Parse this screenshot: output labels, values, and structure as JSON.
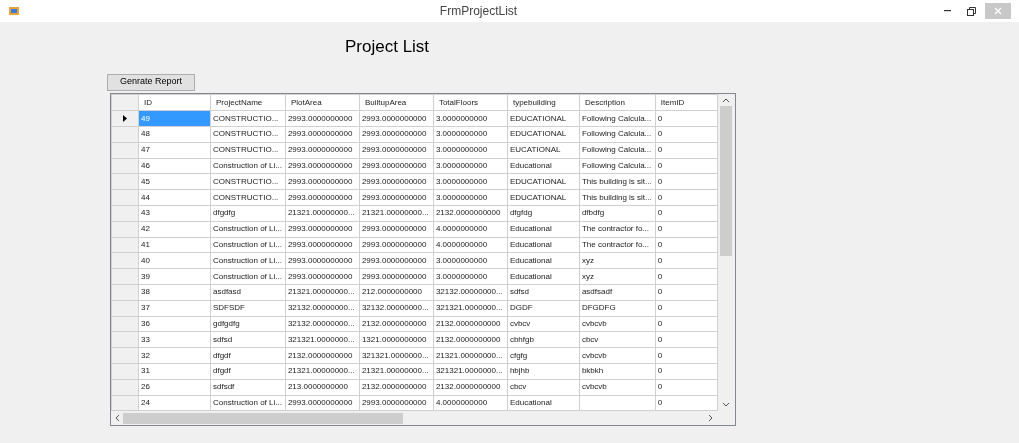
{
  "window": {
    "title": "FrmProjectList"
  },
  "heading": "Project List",
  "report_button": "Genrate Report",
  "table": {
    "columns": [
      "ID",
      "ProjectName",
      "PlotArea",
      "BuiltupArea",
      "TotalFloors",
      "typebuilding",
      "Description",
      "ItemID"
    ],
    "rows": [
      {
        "selected": true,
        "cells": [
          "49",
          "CONSTRUCTIO...",
          "2993.0000000000",
          "2993.0000000000",
          "3.0000000000",
          "EDUCATIONAL",
          "Following Calcula...",
          "0"
        ]
      },
      {
        "selected": false,
        "cells": [
          "48",
          "CONSTRUCTIO...",
          "2993.0000000000",
          "2993.0000000000",
          "3.0000000000",
          "EDUCATIONAL",
          "Following Calcula...",
          "0"
        ]
      },
      {
        "selected": false,
        "cells": [
          "47",
          "CONSTRUCTIO...",
          "2993.0000000000",
          "2993.0000000000",
          "3.0000000000",
          "EUCATIONAL",
          "Following Calcula...",
          "0"
        ]
      },
      {
        "selected": false,
        "cells": [
          "46",
          "Construction of Li...",
          "2993.0000000000",
          "2993.0000000000",
          "3.0000000000",
          "Educational",
          "Following Calcula...",
          "0"
        ]
      },
      {
        "selected": false,
        "cells": [
          "45",
          "CONSTRUCTIO...",
          "2993.0000000000",
          "2993.0000000000",
          "3.0000000000",
          "EDUCATIONAL",
          "This building is sit...",
          "0"
        ]
      },
      {
        "selected": false,
        "cells": [
          "44",
          "CONSTRUCTIO...",
          "2993.0000000000",
          "2993.0000000000",
          "3.0000000000",
          "EDUCATIONAL",
          "This building is sit...",
          "0"
        ]
      },
      {
        "selected": false,
        "cells": [
          "43",
          "dfgdfg",
          "21321.00000000...",
          "21321.00000000...",
          "2132.0000000000",
          "dfgfdg",
          "dfbdfg",
          "0"
        ]
      },
      {
        "selected": false,
        "cells": [
          "42",
          "Construction of Li...",
          "2993.0000000000",
          "2993.0000000000",
          "4.0000000000",
          "Educational",
          "The contractor fo...",
          "0"
        ]
      },
      {
        "selected": false,
        "cells": [
          "41",
          "Construction of Li...",
          "2993.0000000000",
          "2993.0000000000",
          "4.0000000000",
          "Educational",
          "The contractor fo...",
          "0"
        ]
      },
      {
        "selected": false,
        "cells": [
          "40",
          "Construction of Li...",
          "2993.0000000000",
          "2993.0000000000",
          "3.0000000000",
          "Educational",
          "xyz",
          "0"
        ]
      },
      {
        "selected": false,
        "cells": [
          "39",
          "Construction of Li...",
          "2993.0000000000",
          "2993.0000000000",
          "3.0000000000",
          "Educational",
          "xyz",
          "0"
        ]
      },
      {
        "selected": false,
        "cells": [
          "38",
          "asdfasd",
          "21321.00000000...",
          "212.0000000000",
          "32132.00000000...",
          "sdfsd",
          "asdfsadf",
          "0"
        ]
      },
      {
        "selected": false,
        "cells": [
          "37",
          "SDFSDF",
          "32132.00000000...",
          "32132.00000000...",
          "321321.0000000...",
          "DGDF",
          "DFGDFG",
          "0"
        ]
      },
      {
        "selected": false,
        "cells": [
          "36",
          "gdfgdfg",
          "32132.00000000...",
          "2132.0000000000",
          "2132.0000000000",
          "cvbcv",
          "cvbcvb",
          "0"
        ]
      },
      {
        "selected": false,
        "cells": [
          "33",
          "sdfsd",
          "321321.0000000...",
          "1321.0000000000",
          "2132.0000000000",
          "cbhfgb",
          "cbcv",
          "0"
        ]
      },
      {
        "selected": false,
        "cells": [
          "32",
          "dfgdf",
          "2132.0000000000",
          "321321.0000000...",
          "21321.00000000...",
          "cfgfg",
          "cvbcvb",
          "0"
        ]
      },
      {
        "selected": false,
        "cells": [
          "31",
          "dfgdf",
          "21321.00000000...",
          "21321.00000000...",
          "321321.0000000...",
          "hbjhb",
          "bkbkh",
          "0"
        ]
      },
      {
        "selected": false,
        "cells": [
          "26",
          "sdfsdf",
          "213.0000000000",
          "2132.0000000000",
          "2132.0000000000",
          "cbcv",
          "cvbcvb",
          "0"
        ]
      },
      {
        "selected": false,
        "cells": [
          "24",
          "Construction of Li...",
          "2993.0000000000",
          "2993.0000000000",
          "4.0000000000",
          "Educational",
          null,
          "0"
        ]
      }
    ]
  }
}
